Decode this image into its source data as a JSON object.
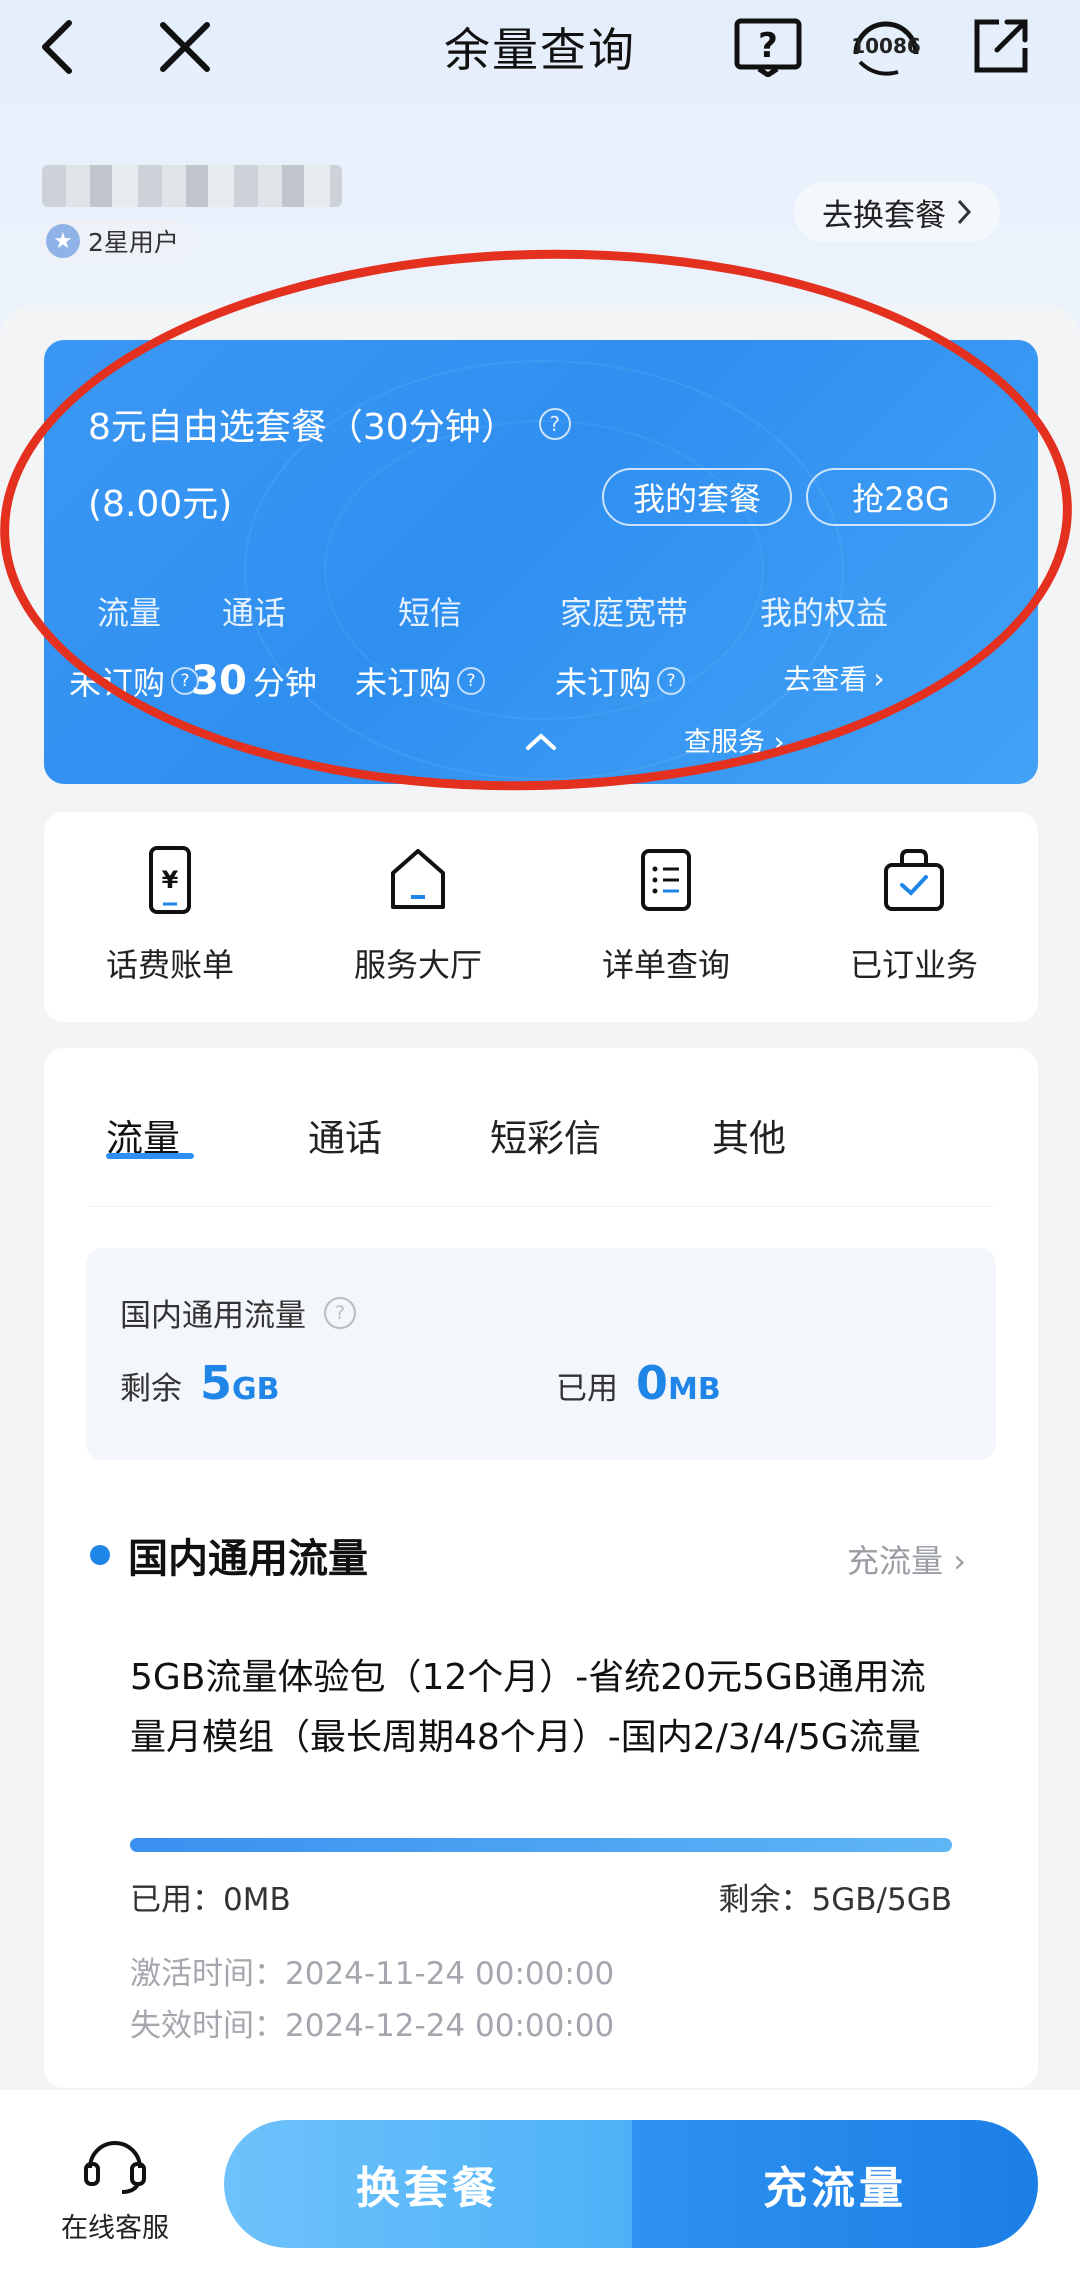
{
  "header": {
    "title": "余量查询",
    "back_icon": "chevron-left-icon",
    "close_icon": "close-icon",
    "help_icon": "question-book-icon",
    "service_label": "10086",
    "share_icon": "share-icon"
  },
  "user": {
    "level": "2星用户",
    "change_plan": "去换套餐"
  },
  "plan": {
    "name": "8元自由选套餐（30分钟）",
    "price": "(8.00元)",
    "my_plan_button": "我的套餐",
    "grab_button": "抢28G",
    "stats": [
      {
        "label": "流量",
        "value": "未订购",
        "has_help": true
      },
      {
        "label": "通话",
        "value_num": "30",
        "value_unit": "分钟",
        "has_help": false
      },
      {
        "label": "短信",
        "value": "未订购",
        "has_help": true
      },
      {
        "label": "家庭宽带",
        "value": "未订购",
        "has_help": true
      },
      {
        "label": "我的权益",
        "value": "去查看",
        "has_help": false
      }
    ],
    "check_service": "查服务"
  },
  "quick_actions": [
    {
      "label": "话费账单",
      "icon": "phone-bill-icon"
    },
    {
      "label": "服务大厅",
      "icon": "home-icon"
    },
    {
      "label": "详单查询",
      "icon": "list-document-icon"
    },
    {
      "label": "已订业务",
      "icon": "bag-check-icon"
    }
  ],
  "tabs": [
    "流量",
    "通话",
    "短彩信",
    "其他"
  ],
  "summary": {
    "title": "国内通用流量",
    "remain_label": "剩余",
    "remain_value": "5",
    "remain_unit": "GB",
    "used_label": "已用",
    "used_value": "0",
    "used_unit": "MB"
  },
  "section": {
    "title": "国内通用流量",
    "recharge_link": "充流量"
  },
  "package": {
    "name": "5GB流量体验包（12个月）-省统20元5GB通用流量月模组（最长周期48个月）-国内2/3/4/5G流量",
    "remaining_fraction": 1.0,
    "used_text": "已用：0MB",
    "remain_text": "剩余：5GB/5GB",
    "activated_text": "激活时间：2024-11-24 00:00:00",
    "expires_text": "失效时间：2024-12-24 00:00:00"
  },
  "bottom": {
    "customer_service": "在线客服",
    "change_plan_button": "换套餐",
    "recharge_button": "充流量"
  },
  "colors": {
    "brand_blue": "#2f8ff0",
    "annotation_red": "#e3301f"
  }
}
